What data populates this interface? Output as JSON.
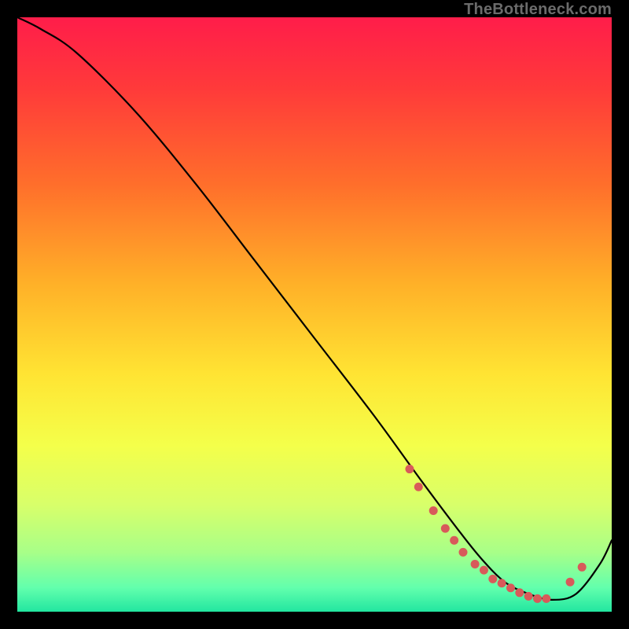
{
  "watermark": "TheBottleneck.com",
  "gradient": {
    "stops": [
      {
        "offset": 0.0,
        "color": "#ff1d4a"
      },
      {
        "offset": 0.12,
        "color": "#ff3a3a"
      },
      {
        "offset": 0.28,
        "color": "#ff6e2b"
      },
      {
        "offset": 0.45,
        "color": "#ffb128"
      },
      {
        "offset": 0.6,
        "color": "#ffe433"
      },
      {
        "offset": 0.72,
        "color": "#f4ff4a"
      },
      {
        "offset": 0.82,
        "color": "#d8ff6a"
      },
      {
        "offset": 0.9,
        "color": "#a8ff88"
      },
      {
        "offset": 0.96,
        "color": "#62ffad"
      },
      {
        "offset": 1.0,
        "color": "#22e6a0"
      }
    ]
  },
  "chart_data": {
    "type": "line",
    "title": "",
    "xlabel": "",
    "ylabel": "",
    "xlim": [
      0,
      100
    ],
    "ylim": [
      0,
      100
    ],
    "series": [
      {
        "name": "bottleneck-curve",
        "x": [
          0,
          4,
          10,
          20,
          30,
          40,
          50,
          60,
          68,
          74,
          78,
          82,
          86,
          90,
          94,
          98,
          100
        ],
        "y": [
          100,
          98,
          94,
          84,
          72,
          59,
          46,
          33,
          22,
          14,
          9,
          5,
          3,
          2,
          3,
          8,
          12
        ]
      }
    ],
    "markers": {
      "name": "highlight-dots",
      "color": "#d85a5a",
      "x": [
        66,
        67.5,
        70,
        72,
        73.5,
        75,
        77,
        78.5,
        80,
        81.5,
        83,
        84.5,
        86,
        87.5,
        89,
        93,
        95
      ],
      "y": [
        24,
        21,
        17,
        14,
        12,
        10,
        8,
        7,
        5.5,
        4.8,
        4,
        3.2,
        2.6,
        2.2,
        2.2,
        5,
        7.5
      ]
    }
  }
}
